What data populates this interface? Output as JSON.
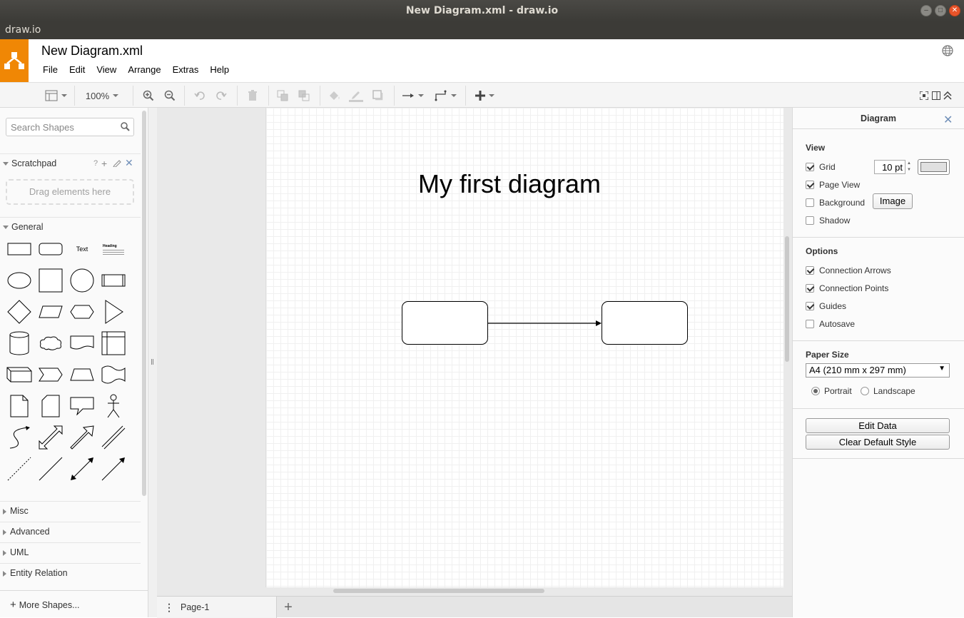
{
  "window": {
    "title": "New Diagram.xml - draw.io",
    "app_name": "draw.io"
  },
  "header": {
    "doc_title": "New Diagram.xml",
    "menu": [
      "File",
      "Edit",
      "View",
      "Arrange",
      "Extras",
      "Help"
    ]
  },
  "toolbar": {
    "zoom": "100%"
  },
  "sidebar": {
    "search_placeholder": "Search Shapes",
    "scratchpad": {
      "label": "Scratchpad",
      "help": "?",
      "dropzone": "Drag elements here"
    },
    "general": {
      "label": "General",
      "text_shape": "Text",
      "heading_shape": "Heading"
    },
    "collapsed_sections": [
      "Misc",
      "Advanced",
      "UML",
      "Entity Relation"
    ],
    "more_shapes": "More Shapes..."
  },
  "canvas": {
    "diagram_title": "My first diagram"
  },
  "pages": {
    "tab": "Page-1"
  },
  "panel": {
    "title": "Diagram",
    "view": {
      "header": "View",
      "grid": {
        "label": "Grid",
        "checked": true,
        "size": "10 pt",
        "color": "#e0e0e0"
      },
      "page_view": {
        "label": "Page View",
        "checked": true
      },
      "background": {
        "label": "Background",
        "checked": false,
        "button": "Image"
      },
      "shadow": {
        "label": "Shadow",
        "checked": false
      }
    },
    "options": {
      "header": "Options",
      "connection_arrows": {
        "label": "Connection Arrows",
        "checked": true
      },
      "connection_points": {
        "label": "Connection Points",
        "checked": true
      },
      "guides": {
        "label": "Guides",
        "checked": true
      },
      "autosave": {
        "label": "Autosave",
        "checked": false
      }
    },
    "paper": {
      "header": "Paper Size",
      "selected": "A4 (210 mm x 297 mm)",
      "portrait": "Portrait",
      "landscape": "Landscape",
      "orientation": "Portrait"
    },
    "buttons": {
      "edit_data": "Edit Data",
      "clear_style": "Clear Default Style"
    }
  },
  "colors": {
    "logo": "#f08705",
    "close_button": "#e9542a",
    "titlebar": "#3c3b37"
  }
}
